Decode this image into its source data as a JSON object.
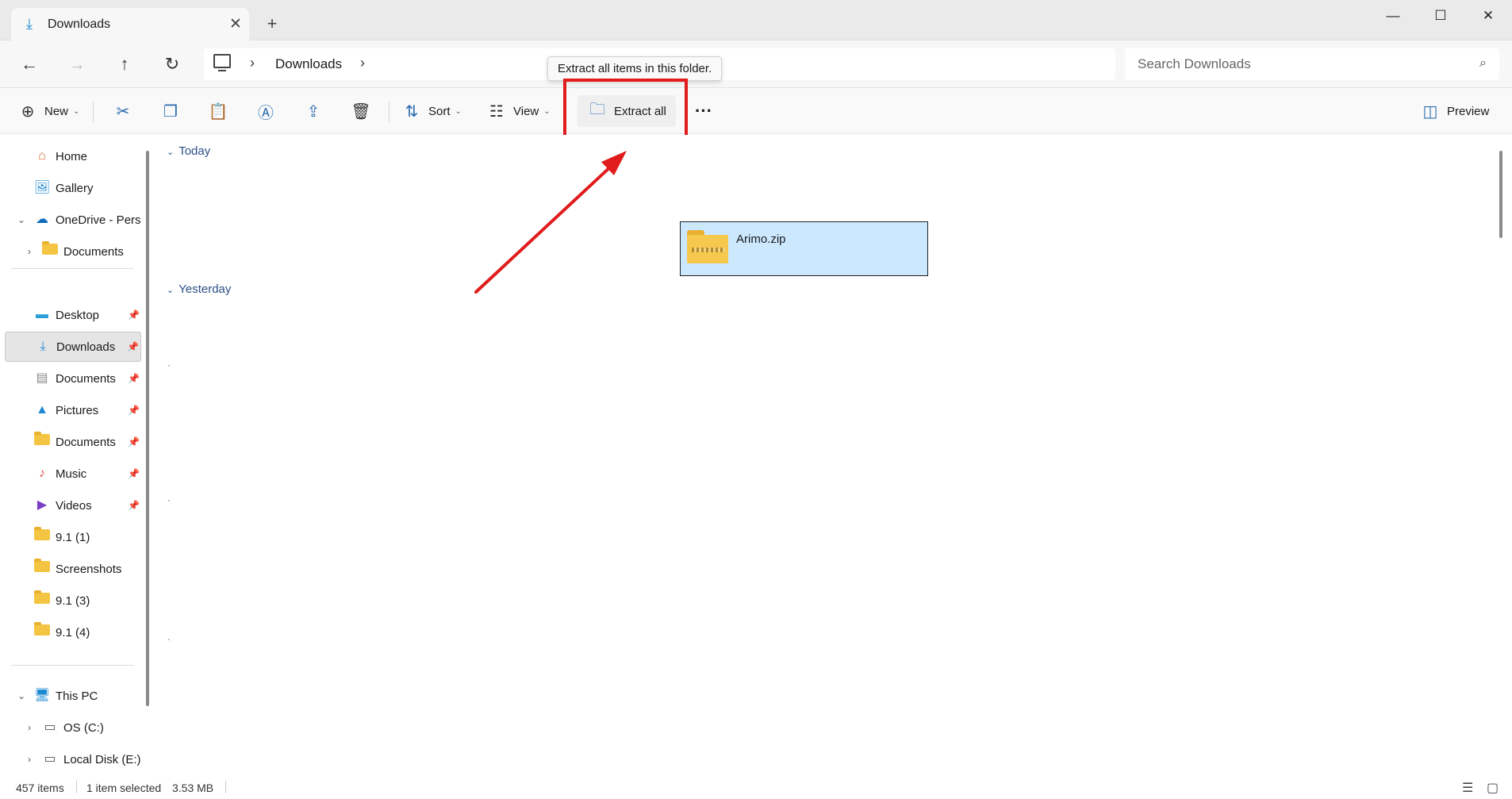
{
  "window": {
    "tab_title": "Downloads",
    "tab_close": "✕",
    "new_tab": "+",
    "minimize": "—",
    "maximize": "☐",
    "close": "✕"
  },
  "nav": {
    "back": "←",
    "forward": "→",
    "up": "↑",
    "refresh": "↻"
  },
  "address": {
    "crumb_chevron": "›",
    "current": "Downloads",
    "trailing_chevron": "›"
  },
  "search": {
    "placeholder": "Search Downloads",
    "icon": "⌕"
  },
  "toolbar": {
    "new_label": "New",
    "sort_label": "Sort",
    "view_label": "View",
    "extract_label": "Extract all",
    "more": "···",
    "preview_label": "Preview",
    "caret": "⌄",
    "tooltip": "Extract all items in this folder."
  },
  "sidebar": {
    "items": [
      {
        "label": "Home",
        "chev": "",
        "icon": "⌂",
        "icon_color": "#d9652b"
      },
      {
        "label": "Gallery",
        "chev": "",
        "icon": "🖼",
        "icon_color": "#1b8ad0"
      },
      {
        "label": "OneDrive - Perso",
        "chev": "⌄",
        "icon": "☁",
        "icon_color": "#0f6cbd"
      },
      {
        "label": "Documents",
        "chev": "›",
        "icon": "folder",
        "icon_color": "#f4c542"
      },
      {
        "label": "Desktop",
        "chev": "",
        "icon": "▬",
        "icon_color": "#2d9fd8",
        "pinned": true
      },
      {
        "label": "Downloads",
        "chev": "",
        "icon": "⤓",
        "icon_color": "#1b8ad0",
        "pinned": true,
        "selected": true
      },
      {
        "label": "Documents",
        "chev": "",
        "icon": "▤",
        "icon_color": "#8a8a8a",
        "pinned": true
      },
      {
        "label": "Pictures",
        "chev": "",
        "icon": "▲",
        "icon_color": "#1b8ad0",
        "pinned": true
      },
      {
        "label": "Documents",
        "chev": "",
        "icon": "folder",
        "icon_color": "#f4c542",
        "pinned": true
      },
      {
        "label": "Music",
        "chev": "",
        "icon": "♪",
        "icon_color": "#d9534f",
        "pinned": true
      },
      {
        "label": "Videos",
        "chev": "",
        "icon": "▶",
        "icon_color": "#7a3fc4",
        "pinned": true
      },
      {
        "label": "9.1 (1)",
        "chev": "",
        "icon": "folder",
        "icon_color": "#f4c542"
      },
      {
        "label": "Screenshots",
        "chev": "",
        "icon": "folder",
        "icon_color": "#f4c542"
      },
      {
        "label": "9.1 (3)",
        "chev": "",
        "icon": "folder",
        "icon_color": "#f4c542"
      },
      {
        "label": "9.1 (4)",
        "chev": "",
        "icon": "folder",
        "icon_color": "#f4c542"
      },
      {
        "label": "This PC",
        "chev": "⌄",
        "icon": "🖥",
        "icon_color": "#1b8ad0"
      },
      {
        "label": "OS (C:)",
        "chev": "›",
        "icon": "▭",
        "icon_color": "#555555"
      },
      {
        "label": "Local Disk (E:)",
        "chev": "›",
        "icon": "▭",
        "icon_color": "#555555"
      }
    ],
    "pin_glyph": "📌"
  },
  "content": {
    "groups": [
      {
        "label": "Today",
        "chev": "⌄"
      },
      {
        "label": "Yesterday",
        "chev": "⌄"
      }
    ],
    "ticks": [
      "`",
      "`",
      "`"
    ],
    "file": {
      "name": "Arimo.zip",
      "selected": true
    }
  },
  "status": {
    "count": "457 items",
    "selection": "1 item selected",
    "size": "3.53 MB",
    "details_icon": "☰",
    "tiles_icon": "▢"
  },
  "colors": {
    "accent": "#1b8ad0",
    "selection": "#cce8ff",
    "annotation": "#e01c1c"
  }
}
